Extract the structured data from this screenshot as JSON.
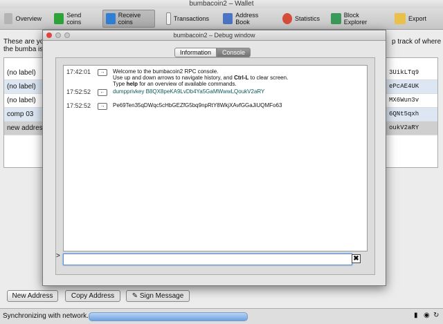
{
  "window": {
    "title": "bumbacoin2 – Wallet"
  },
  "toolbar": {
    "items": [
      {
        "label": "Overview",
        "icon": "overview-icon",
        "color": "#b4b4b4"
      },
      {
        "label": "Send coins",
        "icon": "send-coins-icon",
        "color": "#2da43a"
      },
      {
        "label": "Receive coins",
        "icon": "receive-coins-icon",
        "color": "#2f7fd6"
      },
      {
        "label": "Transactions",
        "icon": "transactions-icon",
        "color": "#f1f1f1"
      },
      {
        "label": "Address Book",
        "icon": "address-book-icon",
        "color": "#4b74c4"
      },
      {
        "label": "Statistics",
        "icon": "statistics-icon",
        "color": "#d74b3b"
      },
      {
        "label": "Block Explorer",
        "icon": "block-explorer-icon",
        "color": "#3a9a5a"
      },
      {
        "label": "Export",
        "icon": "export-icon",
        "color": "#e8c04a"
      }
    ]
  },
  "main": {
    "intro_line1": "These are yo",
    "intro_line2": "the bumba is",
    "intro_right": "p track of where",
    "addresses": [
      {
        "label": "(no label)",
        "address": "3UikLTq9"
      },
      {
        "label": "(no label)",
        "address": "ePcAE4UK"
      },
      {
        "label": "(no label)",
        "address": "MX6Wun3v"
      },
      {
        "label": "comp 03",
        "address": "6QNt5qxh"
      },
      {
        "label": "new address",
        "address": "oukV2aRY"
      }
    ],
    "buttons": {
      "new_address": "New Address",
      "copy_address": "Copy Address",
      "sign_message": "Sign Message"
    }
  },
  "status": {
    "text": "Synchronizing with network...",
    "progress": 1.0
  },
  "debug": {
    "title": "bumbacoin2 – Debug window",
    "tabs": {
      "information": "Information",
      "console": "Console"
    },
    "messages": [
      {
        "time": "17:42:01",
        "line1": "Welcome to the bumbacoin2 RPC console.",
        "line2_a": "Use up and down arrows to navigate history, and ",
        "line2_b": "Ctrl-L",
        "line2_c": " to clear screen.",
        "line3_a": "Type ",
        "line3_b": "help",
        "line3_c": " for an overview of available commands."
      },
      {
        "time": "17:52:52",
        "text": "dumpprivkey B8QX8peKA9LvDb4Ya5GaMWwwLQoukV2aRY"
      },
      {
        "time": "17:52:52",
        "text": "Pe69Ten35qDWqc5cHbGEZfG5bq9npRtY8WkjXAvfGGaJiUQMFo63"
      }
    ],
    "prompt": ">",
    "input_value": "",
    "clear_label": "✖"
  }
}
